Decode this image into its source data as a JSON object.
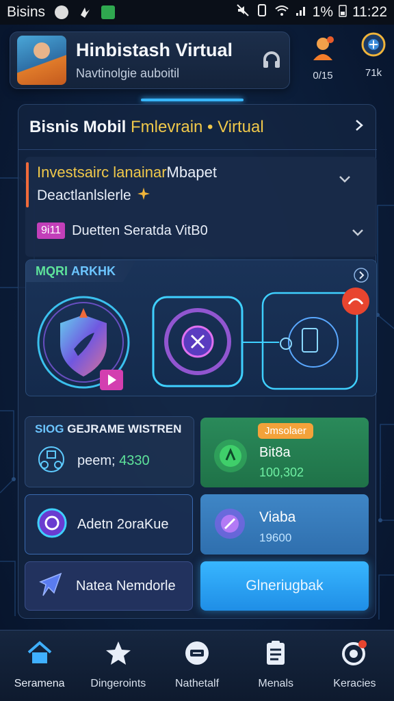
{
  "status_bar": {
    "carrier": "Bisins",
    "signal_percent": "1%",
    "time": "11:22"
  },
  "header": {
    "title": "Hinbistash Virtual",
    "subtitle": "Navtinolgie auboitil",
    "avatar_icon": "person-avatar",
    "action_icon": "headset-icon"
  },
  "top_icons": [
    {
      "icon": "support-agent-icon",
      "label": "0/15"
    },
    {
      "icon": "globe-icon",
      "label": "71k"
    }
  ],
  "section": {
    "title": "Bisnis Mobil",
    "title_accent": "Fmlevrain • Virtual"
  },
  "accordion": {
    "item1_title_yellow": "Investsairc lanainar",
    "item1_title_white": "Mbapet",
    "item1_subtitle": "Deactlanlslerle",
    "item2_badge": "9i11",
    "item2_text": "Duetten Seratda VitB0"
  },
  "feature": {
    "label_green": "MQRI",
    "label_blue": "ARKHK"
  },
  "cards": {
    "stats_title_blue": "SIOG",
    "stats_title_white": "GEJRAME WISTREN",
    "stats_value_prefix": "peem;",
    "stats_value": "4330",
    "green_pill": "Jmsolaer",
    "green_name": "Bit8a",
    "green_number": "100,302",
    "purple_label": "Adetn 2oraKue",
    "blue_name": "Viaba",
    "blue_number": "19600",
    "nav_label": "Natea Nemdorle",
    "cta_label": "Glneriugbak"
  },
  "bottom_nav": [
    {
      "icon": "home-icon",
      "label": "Seramena"
    },
    {
      "icon": "star-icon",
      "label": "Dingeroints"
    },
    {
      "icon": "monitor-icon",
      "label": "Nathetalf"
    },
    {
      "icon": "clipboard-icon",
      "label": "Menals"
    },
    {
      "icon": "target-icon",
      "label": "Keracies"
    }
  ],
  "colors": {
    "accent_blue": "#38b6ff",
    "accent_yellow": "#f0c84a",
    "accent_green": "#2a8a5a",
    "accent_orange": "#f3a23a"
  }
}
